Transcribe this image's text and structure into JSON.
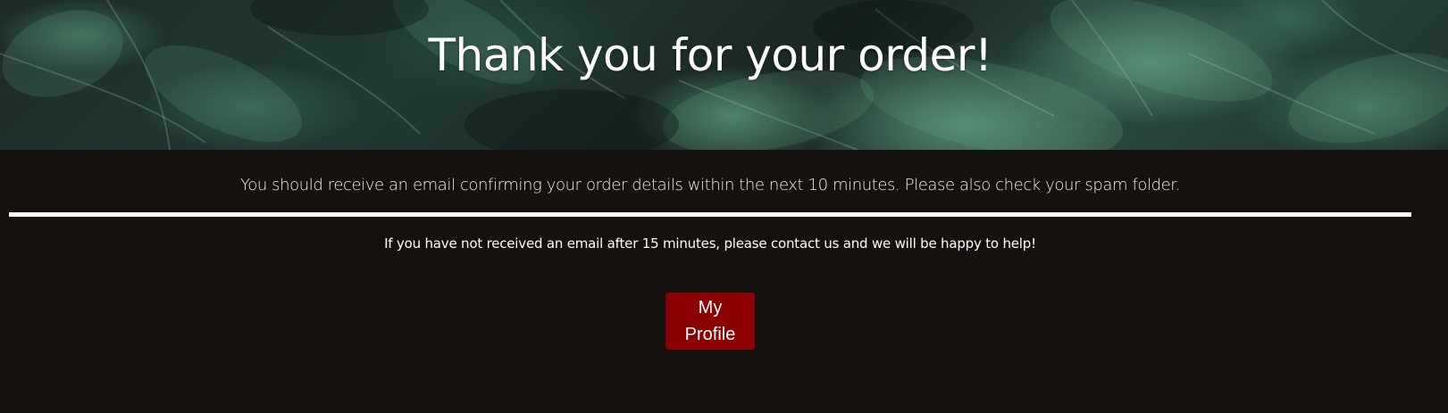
{
  "hero": {
    "title": "Thank you for your order!"
  },
  "main": {
    "confirmation_message": "You should receive an email confirming your order details within the next 10 minutes. Please also check your spam folder.",
    "help_message": "If you have not received an email after 15 minutes, please contact us and we will be happy to help!",
    "profile_button_label": "My Profile"
  },
  "colors": {
    "page_background": "#14110f",
    "divider": "#ffffff",
    "button_background": "#8b0000",
    "text": "#ffffff"
  }
}
